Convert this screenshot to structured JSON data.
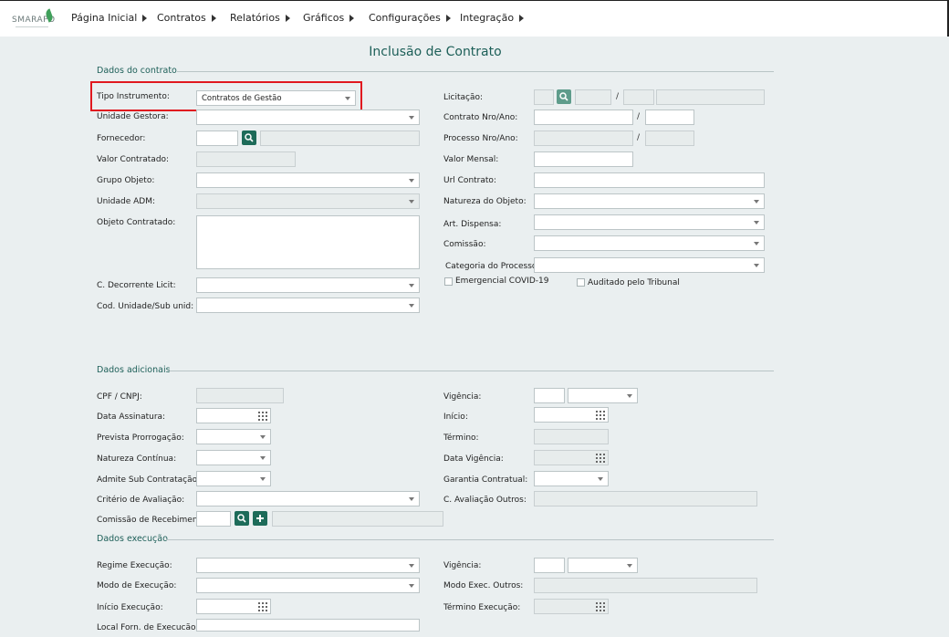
{
  "logo": {
    "text": "SMARAPD"
  },
  "menu": [
    {
      "label": "Página Inicial"
    },
    {
      "label": "Contratos"
    },
    {
      "label": "Relatórios"
    },
    {
      "label": "Gráficos"
    },
    {
      "label": "Configurações"
    },
    {
      "label": "Integração"
    }
  ],
  "page_title": "Inclusão de Contrato",
  "sections": {
    "contrato": "Dados do contrato",
    "adicionais": "Dados adicionais",
    "execucao": "Dados execução"
  },
  "contrato_left": {
    "tipo_instrumento": {
      "label": "Tipo Instrumento:",
      "value": "Contratos de Gestão"
    },
    "unidade_gestora": {
      "label": "Unidade Gestora:"
    },
    "fornecedor": {
      "label": "Fornecedor:"
    },
    "valor_contratado": {
      "label": "Valor Contratado:"
    },
    "grupo_objeto": {
      "label": "Grupo Objeto:"
    },
    "unidade_adm": {
      "label": "Unidade ADM:"
    },
    "objeto_contratado": {
      "label": "Objeto Contratado:"
    },
    "c_decorrente": {
      "label": "C. Decorrente Licit:"
    },
    "cod_unidade": {
      "label": "Cod. Unidade/Sub unid:"
    }
  },
  "contrato_right": {
    "licitacao": {
      "label": "Licitação:"
    },
    "contrato_nro": {
      "label": "Contrato Nro/Ano:"
    },
    "processo_nro": {
      "label": "Processo Nro/Ano:"
    },
    "valor_mensal": {
      "label": "Valor Mensal:"
    },
    "url_contrato": {
      "label": "Url Contrato:"
    },
    "natureza_objeto": {
      "label": "Natureza do Objeto:"
    },
    "art_dispensa": {
      "label": "Art. Dispensa:"
    },
    "comissao": {
      "label": "Comissão:"
    },
    "categoria_processo": {
      "label": "Categoria do Processo:"
    },
    "emergencial": {
      "label": "Emergencial COVID-19"
    },
    "auditado": {
      "label": "Auditado pelo Tribunal"
    },
    "slash": "/"
  },
  "adicionais_left": {
    "cpf_cnpj": {
      "label": "CPF / CNPJ:"
    },
    "data_assinatura": {
      "label": "Data Assinatura:"
    },
    "prevista_prorrogacao": {
      "label": "Prevista Prorrogação:"
    },
    "natureza_continua": {
      "label": "Natureza Contínua:"
    },
    "admite_sub": {
      "label": "Admite Sub Contratação:"
    },
    "criterio_avaliacao": {
      "label": "Critério de Avaliação:"
    },
    "comissao_recebimento": {
      "label": "Comissão de Recebimento:"
    }
  },
  "adicionais_right": {
    "vigencia": {
      "label": "Vigência:"
    },
    "inicio": {
      "label": "Início:"
    },
    "termino": {
      "label": "Término:"
    },
    "data_vigencia": {
      "label": "Data Vigência:"
    },
    "garantia": {
      "label": "Garantia Contratual:"
    },
    "c_avaliacao_outros": {
      "label": "C. Avaliação Outros:"
    }
  },
  "execucao_left": {
    "regime": {
      "label": "Regime Execução:"
    },
    "modo": {
      "label": "Modo de Execução:"
    },
    "inicio_exec": {
      "label": "Início Execução:"
    },
    "local_forn": {
      "label": "Local Forn. de Execucão:"
    }
  },
  "execucao_right": {
    "vigencia": {
      "label": "Vigência:"
    },
    "modo_outros": {
      "label": "Modo Exec. Outros:"
    },
    "termino_exec": {
      "label": "Término Execução:"
    }
  },
  "colors": {
    "accent": "#1d6b59",
    "highlight": "#e0181f",
    "title": "#1d5f58"
  }
}
